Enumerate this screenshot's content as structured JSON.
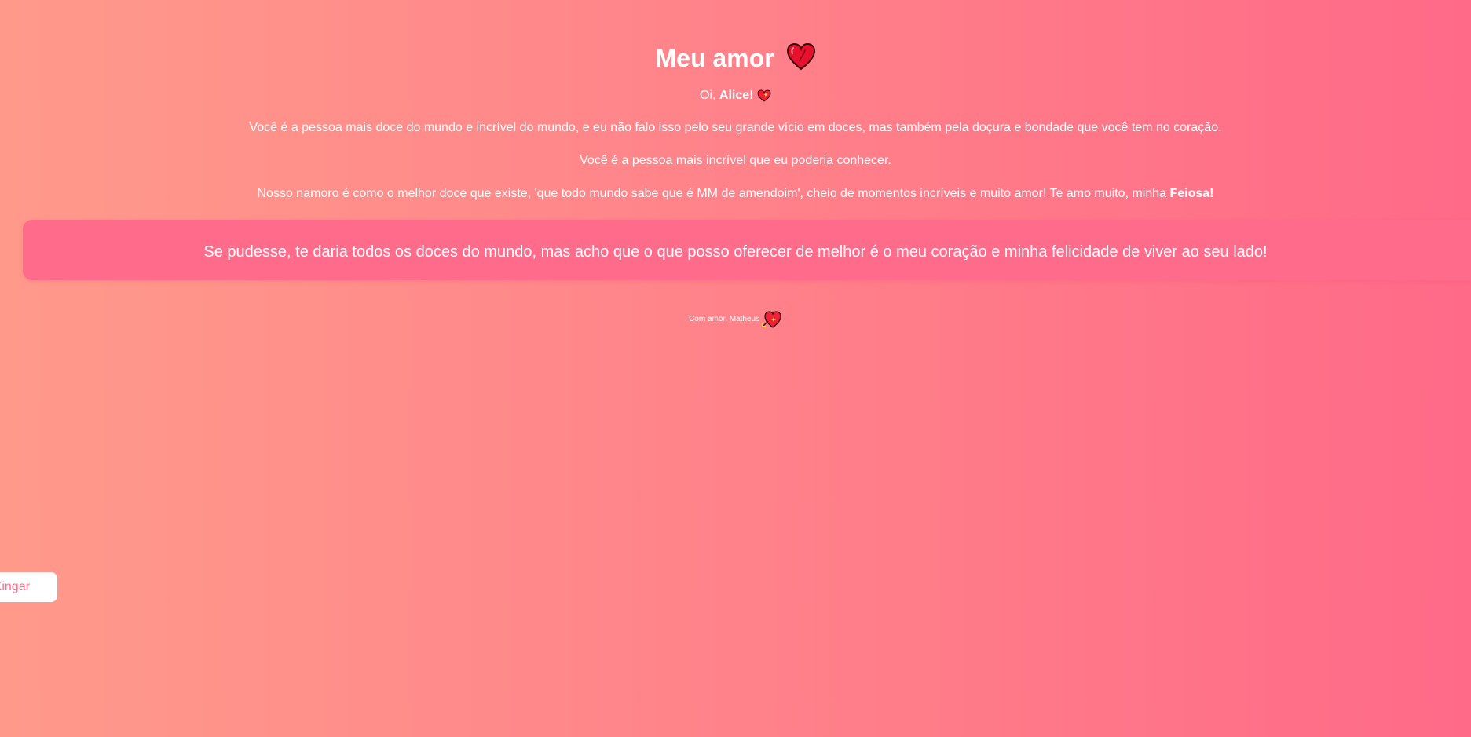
{
  "header": {
    "title": "Meu amor",
    "title_icon": "red-heart-icon"
  },
  "greeting": {
    "prefix": "Oi, ",
    "name": "Alice!",
    "icon": "sparkling-heart-icon"
  },
  "paragraphs": {
    "p1": "Você é a pessoa mais doce do mundo e incrível do mundo, e eu não falo isso pelo seu grande vício em doces, mas também pela doçura e bondade que você tem no coração.",
    "p2": "Você é a pessoa mais incrível que eu poderia conhecer.",
    "p3_text": "Nosso namoro é como o melhor doce que existe, 'que todo mundo sabe que é MM de amendoim', cheio de momentos incríveis e muito amor! Te amo muito, minha ",
    "p3_bold": "Feiosa!"
  },
  "highlight": {
    "text": "Se pudesse, te daria todos os doces do mundo, mas acho que o que posso oferecer de melhor é o meu coração e minha felicidade de viver ao seu lado!"
  },
  "signature": {
    "text": "Com amor, Matheus",
    "icon": "heart-with-arrow-icon"
  },
  "side_button": {
    "label": "Me Xingar"
  },
  "colors": {
    "gradient_start": "#ff9a8b",
    "gradient_end": "#ff6a88",
    "highlight_bg": "#ff6b8b",
    "button_text": "#ff6a88"
  }
}
